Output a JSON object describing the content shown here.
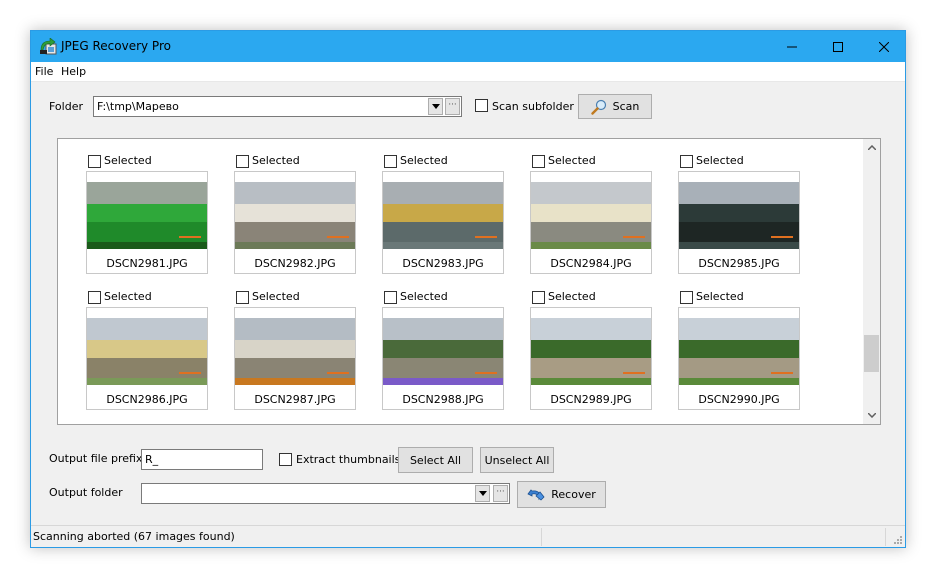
{
  "window": {
    "title": "JPEG Recovery Pro",
    "accent_color": "#2ba8f0",
    "controls": [
      "minimize-icon",
      "maximize-icon",
      "close-icon"
    ]
  },
  "menu": {
    "items": [
      {
        "label": "File",
        "mnemonic": "F"
      },
      {
        "label": "Help",
        "mnemonic": "H"
      }
    ]
  },
  "folder": {
    "label": "Folder",
    "value": "F:\\tmp\\Марево",
    "scan_subfolder_label": "Scan subfolder",
    "scan_subfolder_checked": false,
    "scan_button_label": "Scan"
  },
  "gallery": {
    "items": [
      {
        "checkbox_label": "Selected",
        "checked": false,
        "filename": "DSCN2981.JPG"
      },
      {
        "checkbox_label": "Selected",
        "checked": false,
        "filename": "DSCN2982.JPG"
      },
      {
        "checkbox_label": "Selected",
        "checked": false,
        "filename": "DSCN2983.JPG"
      },
      {
        "checkbox_label": "Selected",
        "checked": false,
        "filename": "DSCN2984.JPG"
      },
      {
        "checkbox_label": "Selected",
        "checked": false,
        "filename": "DSCN2985.JPG"
      },
      {
        "checkbox_label": "Selected",
        "checked": false,
        "filename": "DSCN2986.JPG"
      },
      {
        "checkbox_label": "Selected",
        "checked": false,
        "filename": "DSCN2987.JPG"
      },
      {
        "checkbox_label": "Selected",
        "checked": false,
        "filename": "DSCN2988.JPG"
      },
      {
        "checkbox_label": "Selected",
        "checked": false,
        "filename": "DSCN2989.JPG"
      },
      {
        "checkbox_label": "Selected",
        "checked": false,
        "filename": "DSCN2990.JPG"
      }
    ],
    "scroll_position": 0.85
  },
  "output": {
    "prefix_label": "Output file prefix",
    "prefix_value": "R_",
    "extract_thumbnails_label": "Extract thumbnails",
    "extract_thumbnails_checked": false,
    "select_all_label": "Select All",
    "unselect_all_label": "Unselect All",
    "folder_label": "Output folder",
    "folder_value": "",
    "recover_label": "Recover"
  },
  "status": {
    "text": "Scanning aborted (67 images found)"
  }
}
